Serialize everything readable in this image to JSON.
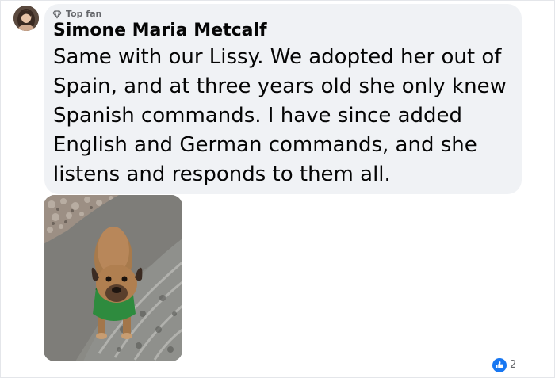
{
  "comment": {
    "badge": {
      "icon": "diamond-icon",
      "label": "Top fan"
    },
    "author": "Simone Maria Metcalf",
    "text": "Same with our Lissy. We adopted her out of Spain, and at three years old she only knew Spanish commands. I have since added English and German commands, and she listens and responds to them all.",
    "attachment": {
      "type": "photo"
    },
    "reactions": {
      "icon": "like-icon",
      "count": "2",
      "color": "#1877f2"
    }
  },
  "colors": {
    "bubble": "#f0f2f5",
    "author_text": "#050505",
    "secondary_text": "#65676b",
    "accent": "#1877f2"
  }
}
